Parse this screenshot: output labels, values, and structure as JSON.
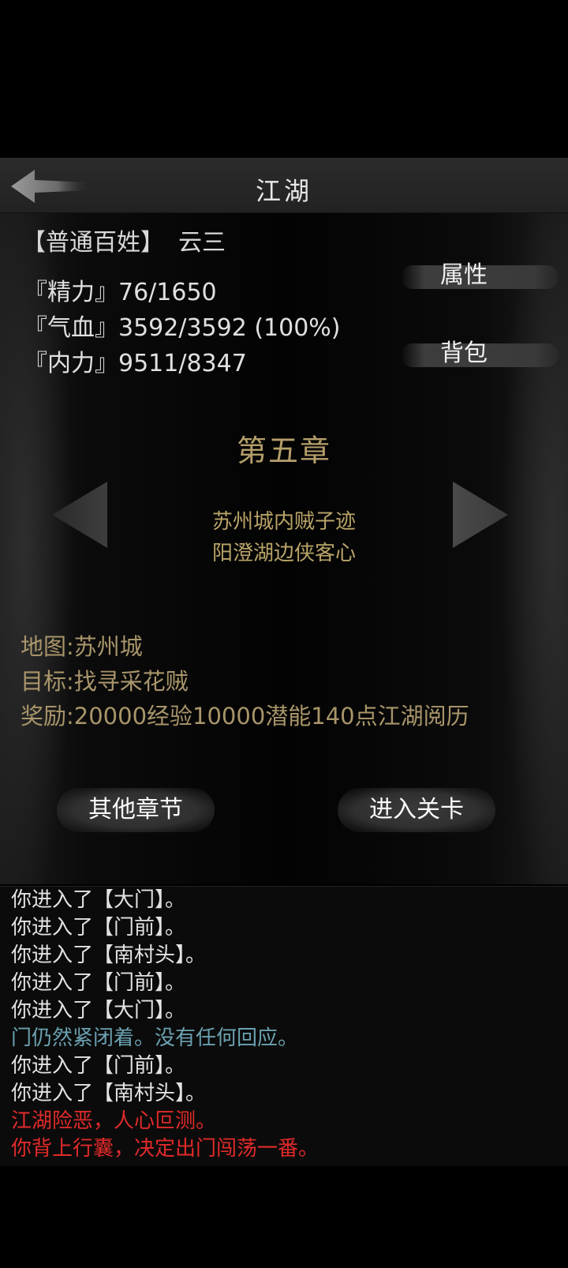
{
  "header": {
    "title": "江湖"
  },
  "player": {
    "rank": "【普通百姓】",
    "name": "云三",
    "stats": [
      {
        "label": "『精力』",
        "value": "76/1650"
      },
      {
        "label": "『气血』",
        "value": "3592/3592 (100%)"
      },
      {
        "label": "『内力』",
        "value": "9511/8347"
      }
    ]
  },
  "side_buttons": {
    "attributes": "属性",
    "bag": "背包"
  },
  "chapter": {
    "title": "第五章",
    "lines": [
      "苏州城内贼子迹",
      "阳澄湖边侠客心"
    ]
  },
  "details": {
    "map": "地图:苏州城",
    "goal": "目标:找寻采花贼",
    "reward": "奖励:20000经验10000潜能140点江湖阅历"
  },
  "actions": {
    "other_chapters": "其他章节",
    "enter_level": "进入关卡"
  },
  "log": [
    {
      "text": "你进入了【大门】。",
      "color": "#e2e2e2"
    },
    {
      "text": "你进入了【门前】。",
      "color": "#e2e2e2"
    },
    {
      "text": "你进入了【南村头】。",
      "color": "#e2e2e2"
    },
    {
      "text": "你进入了【门前】。",
      "color": "#e2e2e2"
    },
    {
      "text": "你进入了【大门】。",
      "color": "#e2e2e2"
    },
    {
      "text": "门仍然紧闭着。没有任何回应。",
      "color": "#6aa1b0"
    },
    {
      "text": "你进入了【门前】。",
      "color": "#e2e2e2"
    },
    {
      "text": "你进入了【南村头】。",
      "color": "#e2e2e2"
    },
    {
      "text": "江湖险恶，人心叵测。",
      "color": "#e12a2a"
    },
    {
      "text": "你背上行囊，决定出门闯荡一番。",
      "color": "#e12a2a"
    }
  ]
}
